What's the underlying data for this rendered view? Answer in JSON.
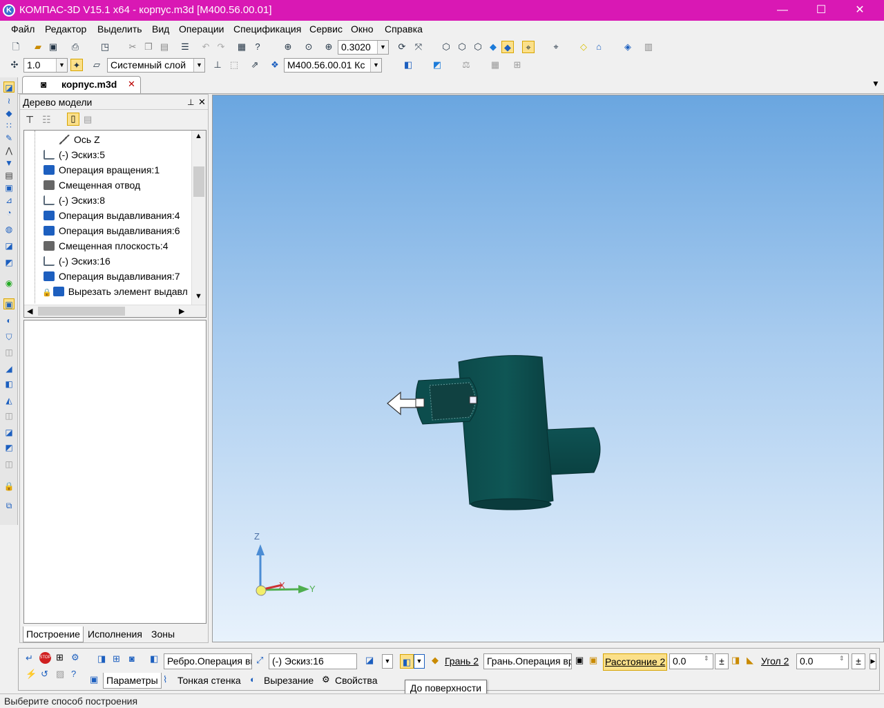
{
  "title": "КОМПАС-3D V15.1 x64 - корпус.m3d [М400.56.00.01]",
  "window_controls": {
    "minimize": "—",
    "maximize": "☐",
    "close": "✕"
  },
  "menu": [
    "Файл",
    "Редактор",
    "Выделить",
    "Вид",
    "Операции",
    "Спецификация",
    "Сервис",
    "Окно",
    "Справка"
  ],
  "toolbar1": {
    "zoom_value": "0.3020"
  },
  "toolbar2": {
    "step_value": "1.0",
    "layer": "Системный слой",
    "designation": "М400.56.00.01 Кс"
  },
  "doc_tab": {
    "label": "корпус.m3d",
    "close": "✕"
  },
  "tree": {
    "title": "Дерево модели",
    "pin": "⊥",
    "close": "✕",
    "items": [
      {
        "label": "Ось Z",
        "color": "#555555"
      },
      {
        "label": "(-) Эскиз:5",
        "color": "#5a6a7a"
      },
      {
        "label": "Операция вращения:1",
        "color": "#1d5fbf"
      },
      {
        "label": "Смещенная отвод",
        "color": "#555555"
      },
      {
        "label": "(-) Эскиз:8",
        "color": "#5a6a7a"
      },
      {
        "label": "Операция выдавливания:4",
        "color": "#1d5fbf"
      },
      {
        "label": "Операция выдавливания:6",
        "color": "#1d5fbf"
      },
      {
        "label": "Смещенная плоскость:4",
        "color": "#555555"
      },
      {
        "label": "(-) Эскиз:16",
        "color": "#5a6a7a"
      },
      {
        "label": "Операция выдавливания:7",
        "color": "#1d5fbf"
      },
      {
        "label": "Вырезать элемент выдавл",
        "color": "#1d5fbf"
      }
    ],
    "bottom_tabs": [
      "Построение",
      "Исполнения",
      "Зоны"
    ]
  },
  "axes": {
    "z": "Z",
    "x": "X",
    "y": "Y"
  },
  "props": {
    "fields": {
      "edge": "Ребро.Операция вы",
      "sketch": "(-) Эскиз:16",
      "face_label": "Грань 2",
      "face_value": "Грань.Операция вр",
      "distance_label": "Расстояние 2",
      "distance_value": "0.0",
      "angle_label": "Угол 2",
      "angle_value": "0.0"
    },
    "tabs": [
      "Параметры",
      "Тонкая стенка",
      "Вырезание",
      "Свойства"
    ]
  },
  "tooltip": "До поверхности",
  "status": "Выберите способ построения"
}
